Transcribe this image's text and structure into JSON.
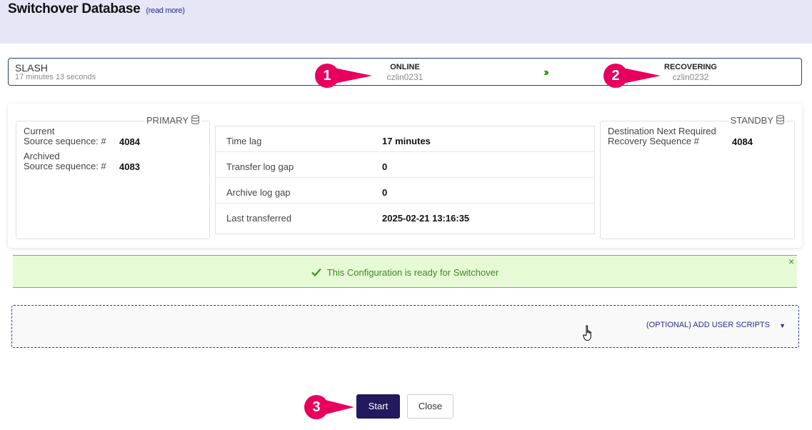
{
  "header": {
    "title": "Switchover Database",
    "read_more": "(read more)"
  },
  "summary": {
    "db_name": "SLASH",
    "uptime": "17 minutes 13 seconds",
    "primary_status": "ONLINE",
    "primary_host": "czlin0231",
    "standby_status": "RECOVERING",
    "standby_host": "czlin0232",
    "arrow_icon": "double-chevron-right-icon"
  },
  "markers": [
    "1",
    "2",
    "3"
  ],
  "primary_panel": {
    "legend": "PRIMARY",
    "current_label_1": "Current",
    "current_label_2": "Source sequence: #",
    "current_value": "4084",
    "archived_label_1": "Archived",
    "archived_label_2": "Source sequence: #",
    "archived_value": "4083"
  },
  "metrics": [
    {
      "label": "Time lag",
      "value": "17 minutes"
    },
    {
      "label": "Transfer log gap",
      "value": "0"
    },
    {
      "label": "Archive log gap",
      "value": "0"
    },
    {
      "label": "Last transferred",
      "value": "2025-02-21 13:16:35"
    }
  ],
  "standby_panel": {
    "legend": "STANDBY",
    "label_1": "Destination Next Required",
    "label_2": "Recovery Sequence #",
    "value": "4084"
  },
  "banner": {
    "message": "This Configuration is ready for Switchover",
    "close": "×",
    "color": "#3c8a22"
  },
  "scripts": {
    "toggle_label": "(OPTIONAL) ADD USER SCRIPTS",
    "caret": "▼"
  },
  "actions": {
    "start_label": "Start",
    "close_label": "Close"
  },
  "colors": {
    "accent": "#22195e",
    "marker": "#e8005e",
    "header_bg": "#e6e6f7"
  }
}
